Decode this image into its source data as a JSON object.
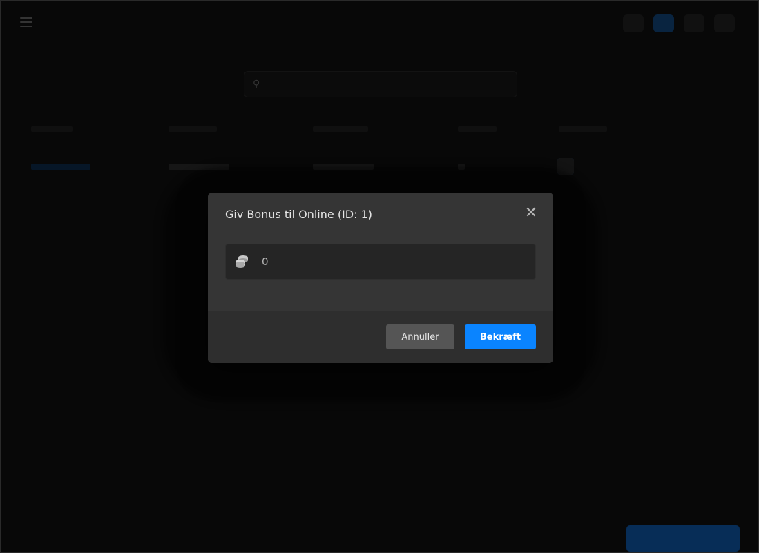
{
  "modal": {
    "title": "Giv Bonus til Online (ID: 1)",
    "close_icon": "close-icon",
    "bonus_input": {
      "icon": "coins-icon",
      "value": "0"
    },
    "buttons": {
      "cancel": "Annuller",
      "confirm": "Bekræft"
    }
  },
  "colors": {
    "confirm_button": "#0a84ff",
    "cancel_button": "#555555",
    "modal_background": "#353535"
  }
}
